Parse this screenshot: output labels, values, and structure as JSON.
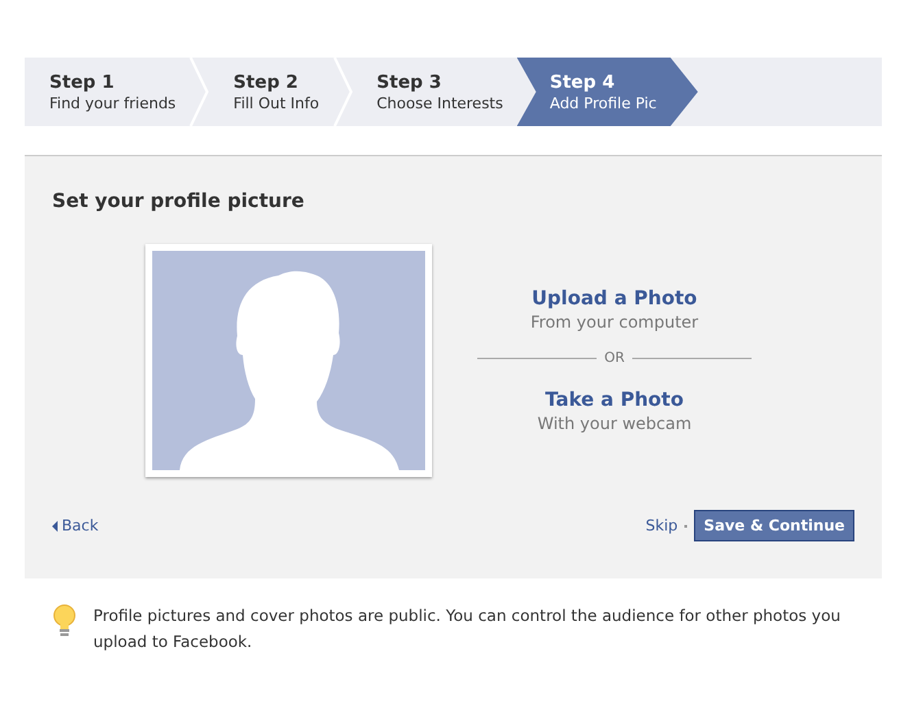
{
  "steps": [
    {
      "title": "Step 1",
      "subtitle": "Find your friends",
      "selected": false
    },
    {
      "title": "Step 2",
      "subtitle": "Fill Out Info",
      "selected": false
    },
    {
      "title": "Step 3",
      "subtitle": "Choose Interests",
      "selected": false
    },
    {
      "title": "Step 4",
      "subtitle": "Add Profile Pic",
      "selected": true
    }
  ],
  "panel": {
    "heading": "Set your profile picture",
    "options": [
      {
        "title": "Upload a Photo",
        "subtitle": "From your computer"
      },
      {
        "title": "Take a Photo",
        "subtitle": "With your webcam"
      }
    ],
    "separator": "OR",
    "back": "Back",
    "skip": "Skip",
    "primary_button": "Save & Continue"
  },
  "tip": "Profile pictures and cover photos are public. You can control the audience for other photos you upload to Facebook."
}
